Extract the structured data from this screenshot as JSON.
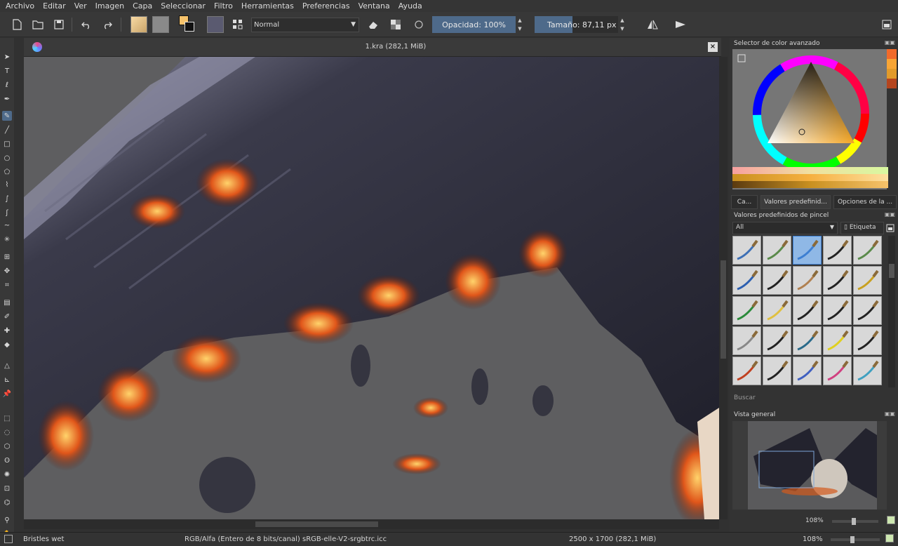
{
  "menu": [
    "Archivo",
    "Editar",
    "Ver",
    "Imagen",
    "Capa",
    "Seleccionar",
    "Filtro",
    "Herramientas",
    "Preferencias",
    "Ventana",
    "Ayuda"
  ],
  "toolbar": {
    "blend_mode": "Normal",
    "opacity_label": "Opacidad:",
    "opacity_value": "100%",
    "opacity_fraction": 1.0,
    "size_label": "Tamaño:",
    "size_value": "87,11 px",
    "size_fraction": 0.45
  },
  "document": {
    "title": "1.kra (282,1 MiB)"
  },
  "dockers": {
    "color_selector_title": "Selector de color avanzado",
    "tabs": [
      "Ca...",
      "Valores predefinid...",
      "Opciones de la ..."
    ],
    "presets_title": "Valores predefinidos de pincel",
    "presets_filter": "All",
    "tag_button": "Etiqueta",
    "search_placeholder": "Buscar",
    "overview_title": "Vista general",
    "overview_zoom": "108%"
  },
  "status": {
    "brush_name": "Bristles wet",
    "color_space": "RGB/Alfa (Entero de 8 bits/canal)  sRGB-elle-V2-srgbtrc.icc",
    "dimensions": "2500 x 1700 (282,1 MiB)",
    "zoom": "108%"
  },
  "colors": {
    "accent": "#4e6a8a",
    "foreground": "#f6c26b",
    "background": "#111111",
    "recent_colors": [
      "#f26a2a",
      "#f8a535",
      "#e29a2a",
      "#b5451e"
    ]
  },
  "icons": {
    "tools": [
      "pointer-icon",
      "text-icon",
      "calligraphy-icon",
      "edit-shapes-icon",
      "freehand-brush-icon",
      "line-icon",
      "rectangle-icon",
      "ellipse-icon",
      "polygon-icon",
      "polyline-icon",
      "bezier-icon",
      "freehand-path-icon",
      "dynamic-brush-icon",
      "multibrush-icon",
      "transform-icon",
      "move-icon",
      "crop-icon",
      "gradient-icon",
      "color-picker-icon",
      "smart-patch-icon",
      "fill-icon",
      "assistant-icon",
      "measure-icon",
      "reference-icon",
      "rect-select-icon",
      "ellipse-select-icon",
      "polygon-select-icon",
      "freehand-select-icon",
      "contiguous-select-icon",
      "similar-select-icon",
      "bezier-select-icon",
      "zoom-icon",
      "pan-icon"
    ]
  }
}
